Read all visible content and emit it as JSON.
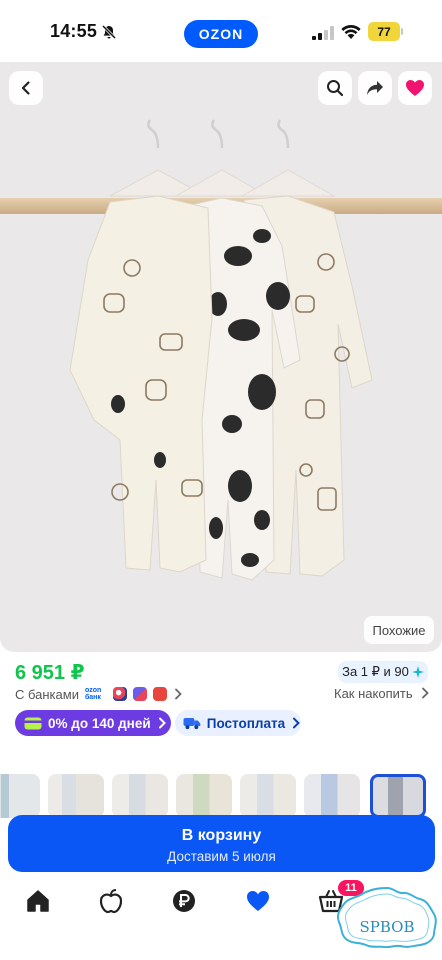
{
  "status_bar": {
    "time": "14:55",
    "brand": "OZON",
    "battery": "77"
  },
  "product": {
    "similar_label": "Похожие",
    "price": "6 951 ₽",
    "bonus": "За 1 ₽ и 90",
    "banks_label": "С банками",
    "bank_logo": "ozon банк",
    "save_link": "Как накопить",
    "installment": "0% до 140 дней",
    "postpay": "Постоплата"
  },
  "cart": {
    "label": "В корзину",
    "delivery": "Доставим 5 июля"
  },
  "tabbar": {
    "cart_badge": "11"
  },
  "watermark": "SPBOB",
  "colors": {
    "brand_blue": "#005bff",
    "price_green": "#10c44c",
    "installment_purple": "#6c3ce2",
    "badge_pink": "#f8145f",
    "favorite_pink": "#f0146e"
  }
}
